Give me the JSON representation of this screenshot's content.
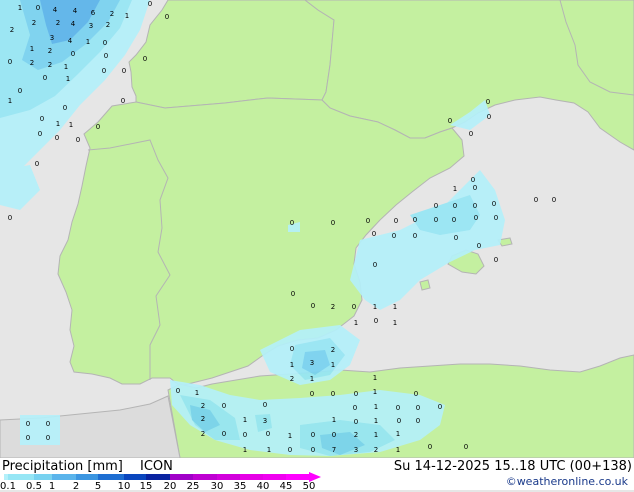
{
  "footer": {
    "title": "Precipitation [mm]",
    "model": "ICON",
    "valid_time": "Su 14-12-2025 15..18 UTC (00+138)",
    "credit": "©weatheronline.co.uk"
  },
  "legend": {
    "ticks": [
      "0.1",
      "0.5",
      "1",
      "2",
      "5",
      "10",
      "15",
      "20",
      "25",
      "30",
      "35",
      "40",
      "45",
      "50"
    ],
    "colors": [
      "#b4f0fa",
      "#96e6f5",
      "#78d2f0",
      "#5ab4eb",
      "#3c96e1",
      "#1e6ed2",
      "#0a46be",
      "#0a23a0",
      "#a000c8",
      "#be00d2",
      "#d200dc",
      "#e600e6",
      "#f000f0",
      "#ff00ff"
    ]
  },
  "colors": {
    "sea": "#e6e6e6",
    "land_focus": "#c4f0a0",
    "land_other": "#dcdcdc",
    "border": "#b4b4b4"
  },
  "labels": [
    [
      "1",
      20,
      7
    ],
    [
      "0",
      38,
      7
    ],
    [
      "4",
      55,
      9
    ],
    [
      "4",
      75,
      10
    ],
    [
      "6",
      93,
      12
    ],
    [
      "2",
      112,
      13
    ],
    [
      "1",
      127,
      15
    ],
    [
      "0",
      150,
      3
    ],
    [
      "0",
      167,
      16
    ],
    [
      "2",
      12,
      29
    ],
    [
      "2",
      34,
      22
    ],
    [
      "2",
      58,
      22
    ],
    [
      "4",
      73,
      23
    ],
    [
      "3",
      91,
      25
    ],
    [
      "2",
      108,
      24
    ],
    [
      "3",
      52,
      37
    ],
    [
      "4",
      70,
      40
    ],
    [
      "1",
      88,
      41
    ],
    [
      "0",
      105,
      42
    ],
    [
      "1",
      32,
      48
    ],
    [
      "2",
      50,
      50
    ],
    [
      "0",
      73,
      53
    ],
    [
      "0",
      106,
      55
    ],
    [
      "0",
      145,
      58
    ],
    [
      "0",
      10,
      61
    ],
    [
      "2",
      32,
      62
    ],
    [
      "2",
      50,
      64
    ],
    [
      "1",
      66,
      66
    ],
    [
      "0",
      104,
      70
    ],
    [
      "0",
      124,
      70
    ],
    [
      "0",
      45,
      77
    ],
    [
      "1",
      68,
      78
    ],
    [
      "0",
      20,
      90
    ],
    [
      "1",
      10,
      100
    ],
    [
      "0",
      65,
      107
    ],
    [
      "0",
      123,
      100
    ],
    [
      "0",
      42,
      118
    ],
    [
      "1",
      58,
      123
    ],
    [
      "1",
      71,
      124
    ],
    [
      "0",
      98,
      126
    ],
    [
      "0",
      40,
      133
    ],
    [
      "0",
      57,
      137
    ],
    [
      "0",
      78,
      139
    ],
    [
      "0",
      37,
      163
    ],
    [
      "0",
      10,
      217
    ],
    [
      "0",
      488,
      101
    ],
    [
      "0",
      489,
      116
    ],
    [
      "0",
      450,
      120
    ],
    [
      "0",
      471,
      133
    ],
    [
      "0",
      292,
      222
    ],
    [
      "0",
      333,
      222
    ],
    [
      "0",
      368,
      220
    ],
    [
      "0",
      396,
      220
    ],
    [
      "0",
      415,
      219
    ],
    [
      "0",
      436,
      219
    ],
    [
      "0",
      454,
      219
    ],
    [
      "0",
      476,
      217
    ],
    [
      "0",
      496,
      217
    ],
    [
      "0",
      536,
      199
    ],
    [
      "0",
      554,
      199
    ],
    [
      "0",
      473,
      179
    ],
    [
      "0",
      436,
      205
    ],
    [
      "0",
      455,
      205
    ],
    [
      "0",
      475,
      205
    ],
    [
      "0",
      494,
      203
    ],
    [
      "1",
      455,
      188
    ],
    [
      "0",
      475,
      187
    ],
    [
      "0",
      374,
      233
    ],
    [
      "0",
      394,
      235
    ],
    [
      "0",
      415,
      235
    ],
    [
      "0",
      456,
      237
    ],
    [
      "0",
      479,
      245
    ],
    [
      "0",
      496,
      259
    ],
    [
      "0",
      375,
      264
    ],
    [
      "0",
      293,
      293
    ],
    [
      "0",
      313,
      305
    ],
    [
      "2",
      333,
      306
    ],
    [
      "0",
      354,
      306
    ],
    [
      "1",
      375,
      306
    ],
    [
      "1",
      395,
      306
    ],
    [
      "1",
      356,
      322
    ],
    [
      "0",
      376,
      320
    ],
    [
      "1",
      395,
      322
    ],
    [
      "0",
      292,
      348
    ],
    [
      "2",
      333,
      349
    ],
    [
      "1",
      292,
      364
    ],
    [
      "3",
      312,
      362
    ],
    [
      "1",
      333,
      364
    ],
    [
      "2",
      292,
      378
    ],
    [
      "1",
      312,
      378
    ],
    [
      "1",
      375,
      377
    ],
    [
      "0",
      178,
      390
    ],
    [
      "1",
      197,
      392
    ],
    [
      "0",
      312,
      393
    ],
    [
      "0",
      333,
      393
    ],
    [
      "0",
      356,
      393
    ],
    [
      "1",
      375,
      391
    ],
    [
      "0",
      416,
      393
    ],
    [
      "2",
      203,
      405
    ],
    [
      "0",
      224,
      405
    ],
    [
      "0",
      265,
      404
    ],
    [
      "0",
      355,
      407
    ],
    [
      "1",
      376,
      406
    ],
    [
      "0",
      398,
      407
    ],
    [
      "0",
      418,
      407
    ],
    [
      "0",
      440,
      406
    ],
    [
      "2",
      203,
      418
    ],
    [
      "1",
      245,
      419
    ],
    [
      "3",
      265,
      420
    ],
    [
      "1",
      334,
      419
    ],
    [
      "0",
      356,
      421
    ],
    [
      "1",
      376,
      420
    ],
    [
      "0",
      399,
      420
    ],
    [
      "0",
      418,
      420
    ],
    [
      "2",
      203,
      433
    ],
    [
      "0",
      224,
      433
    ],
    [
      "0",
      245,
      434
    ],
    [
      "0",
      268,
      433
    ],
    [
      "1",
      290,
      435
    ],
    [
      "0",
      313,
      434
    ],
    [
      "0",
      334,
      434
    ],
    [
      "2",
      356,
      434
    ],
    [
      "1",
      376,
      434
    ],
    [
      "1",
      398,
      433
    ],
    [
      "0",
      28,
      423
    ],
    [
      "0",
      48,
      423
    ],
    [
      "0",
      28,
      437
    ],
    [
      "0",
      48,
      437
    ],
    [
      "1",
      245,
      449
    ],
    [
      "1",
      269,
      449
    ],
    [
      "0",
      290,
      449
    ],
    [
      "0",
      313,
      449
    ],
    [
      "7",
      334,
      449
    ],
    [
      "3",
      356,
      449
    ],
    [
      "2",
      376,
      449
    ],
    [
      "1",
      398,
      449
    ],
    [
      "0",
      430,
      446
    ],
    [
      "0",
      466,
      446
    ]
  ]
}
